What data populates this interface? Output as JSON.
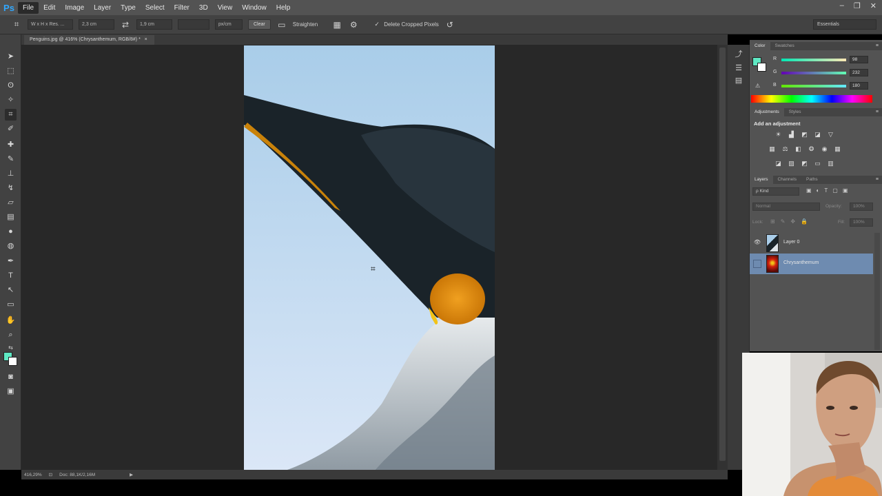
{
  "app": {
    "logo": "Ps"
  },
  "menu": [
    "File",
    "Edit",
    "Image",
    "Layer",
    "Type",
    "Select",
    "Filter",
    "3D",
    "View",
    "Window",
    "Help"
  ],
  "window_controls": [
    "–",
    "❐",
    "✕"
  ],
  "options": {
    "ratio": "W x H x Res. ...",
    "width": "2,3 cm",
    "height": "1,9 cm",
    "resolution": "",
    "unit": "px/cm",
    "clear": "Clear",
    "straighten": "Straighten",
    "delete_cropped": "Delete Cropped Pixels",
    "workspace": "Essentials"
  },
  "document": {
    "tab_title": "Penguins.jpg @ 416% (Chrysanthemum, RGB/8#) *",
    "zoom": "416,29%",
    "doc_size": "Doc: 88,1K/2,16M"
  },
  "colors": {
    "foreground": "#5fe8c3",
    "background": "#ffffff"
  },
  "color_panel": {
    "tabs": [
      "Color",
      "Swatches"
    ],
    "r": {
      "label": "R",
      "value": "98"
    },
    "g": {
      "label": "G",
      "value": "232"
    },
    "b": {
      "label": "B",
      "value": "180"
    }
  },
  "adjustments_panel": {
    "tabs": [
      "Adjustments",
      "Styles"
    ],
    "title": "Add an adjustment"
  },
  "layers_panel": {
    "tabs": [
      "Layers",
      "Channels",
      "Paths"
    ],
    "filter": "ρ Kind",
    "blend_mode": "Normal",
    "opacity_label": "Opacity:",
    "opacity": "100%",
    "lock_label": "Lock:",
    "fill_label": "Fill:",
    "fill": "100%",
    "layers": [
      {
        "name": "Layer 0",
        "visible": true,
        "selected": false
      },
      {
        "name": "Chrysanthemum",
        "visible": false,
        "selected": true
      }
    ]
  }
}
